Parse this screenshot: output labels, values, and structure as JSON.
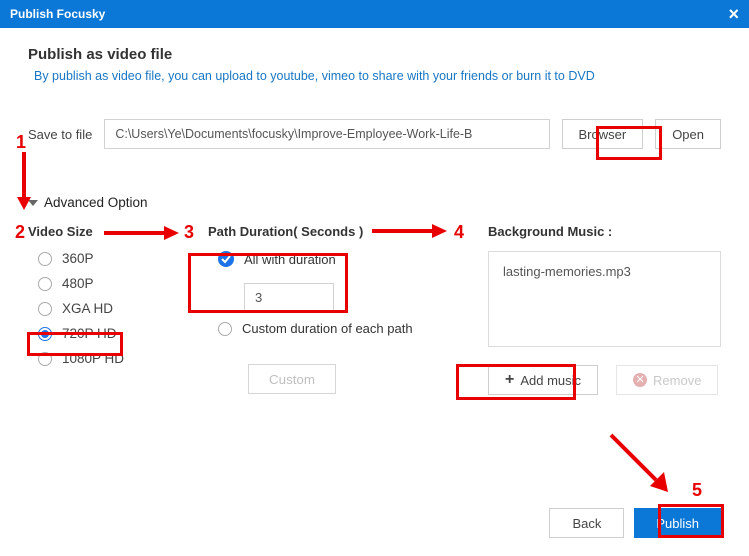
{
  "titlebar": {
    "title": "Publish Focusky",
    "close": "×"
  },
  "header": {
    "heading": "Publish as video file",
    "subtitle": "By publish as video file, you can upload to youtube, vimeo to share with your friends or burn it to DVD"
  },
  "save": {
    "label": "Save to file",
    "path": "C:\\Users\\Ye\\Documents\\focusky\\Improve-Employee-Work-Life-B",
    "browser": "Browser",
    "open": "Open"
  },
  "advanced": {
    "label": "Advanced Option"
  },
  "videoSize": {
    "title": "Video Size",
    "options": [
      "360P",
      "480P",
      "XGA HD",
      "720P HD",
      "1080P HD"
    ],
    "selected": "720P HD"
  },
  "pathDuration": {
    "title": "Path Duration( Seconds )",
    "allLabel": "All with duration",
    "value": "3",
    "customLabel": "Custom duration of each path",
    "customBtn": "Custom"
  },
  "music": {
    "title": "Background Music :",
    "file": "lasting-memories.mp3",
    "add": "Add music",
    "remove": "Remove"
  },
  "footer": {
    "back": "Back",
    "publish": "Publish"
  },
  "annotations": {
    "n1": "1",
    "n2": "2",
    "n3": "3",
    "n4": "4",
    "n5": "5"
  }
}
